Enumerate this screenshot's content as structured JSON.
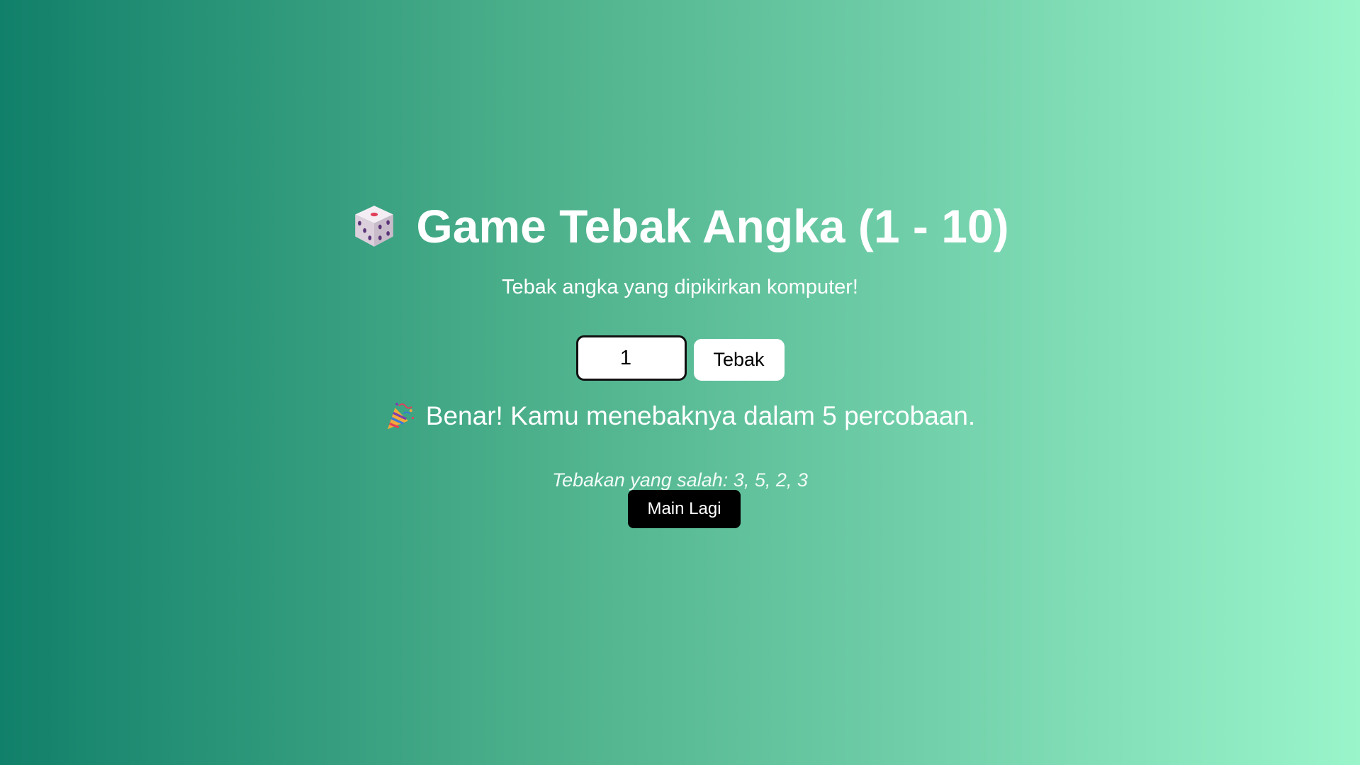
{
  "header": {
    "title_icon": "dice-icon",
    "title": "Game Tebak Angka (1 - 10)",
    "subtitle": "Tebak angka yang dipikirkan komputer!"
  },
  "form": {
    "input_value": "1",
    "guess_button_label": "Tebak"
  },
  "result": {
    "icon": "party-popper-icon",
    "message": "Benar! Kamu menebaknya dalam 5 percobaan."
  },
  "wrong_guesses": {
    "text": "Tebakan yang salah: 3, 5, 2, 3"
  },
  "restart": {
    "label": "Main Lagi"
  },
  "colors": {
    "gradient_start": "#11806a",
    "gradient_end": "#9af5cb",
    "restart_button_bg": "#000000",
    "guess_button_bg": "#ffffff"
  }
}
